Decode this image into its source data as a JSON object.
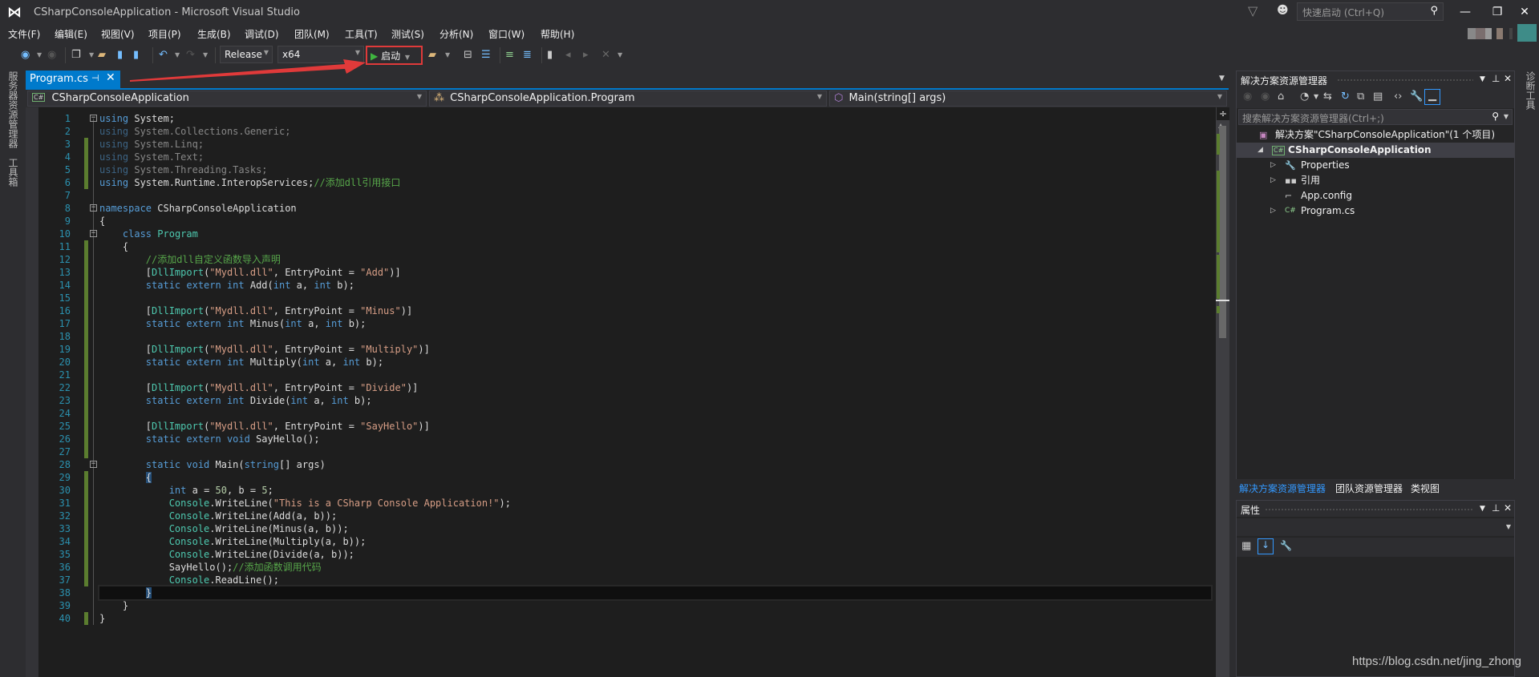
{
  "window": {
    "title": "CSharpConsoleApplication - Microsoft Visual Studio",
    "quick_launch_placeholder": "快速启动 (Ctrl+Q)",
    "controls": {
      "minimize": "—",
      "restore": "❐",
      "close": "✕"
    }
  },
  "menu": [
    "文件(F)",
    "编辑(E)",
    "视图(V)",
    "项目(P)",
    "生成(B)",
    "调试(D)",
    "团队(M)",
    "工具(T)",
    "测试(S)",
    "分析(N)",
    "窗口(W)",
    "帮助(H)"
  ],
  "toolbar": {
    "configuration": "Release",
    "platform": "x64",
    "start_label": "启动",
    "icons": [
      "back-icon",
      "forward-icon",
      "new-project-icon",
      "open-file-icon",
      "save-icon",
      "save-all-icon",
      "undo-icon",
      "redo-icon",
      "find-in-files-icon",
      "step-into-icon",
      "step-over-icon",
      "comment-icon",
      "uncomment-icon",
      "bookmark-icon",
      "prev-bookmark-icon",
      "next-bookmark-icon",
      "clear-bookmarks-icon"
    ]
  },
  "left_strip": {
    "tabs": [
      "服务器资源管理器",
      "工具箱"
    ]
  },
  "right_strip": {
    "tabs": [
      "诊断工具"
    ]
  },
  "document_tab": {
    "label": "Program.cs",
    "pin": "⊣",
    "close": "✕"
  },
  "navbar": {
    "project": "CSharpConsoleApplication",
    "type": "CSharpConsoleApplication.Program",
    "member": "Main(string[] args)"
  },
  "editor": {
    "lines": [
      {
        "n": "1",
        "html": "<span class='k'>using</span> System;"
      },
      {
        "n": "2",
        "html": "<span class='dim'><span class='k'>using</span> System.Collections.Generic;</span>"
      },
      {
        "n": "3",
        "html": "<span class='dim'><span class='k'>using</span> System.Linq;</span>"
      },
      {
        "n": "4",
        "html": "<span class='dim'><span class='k'>using</span> System.Text;</span>"
      },
      {
        "n": "5",
        "html": "<span class='dim'><span class='k'>using</span> System.Threading.Tasks;</span>"
      },
      {
        "n": "6",
        "html": "<span class='k'>using</span> System.Runtime.InteropServices;<span class='c'>//添加dll引用接口</span>"
      },
      {
        "n": "7",
        "html": ""
      },
      {
        "n": "8",
        "html": "<span class='k'>namespace</span> CSharpConsoleApplication"
      },
      {
        "n": "9",
        "html": "{"
      },
      {
        "n": "10",
        "html": "    <span class='k'>class</span> <span class='t'>Program</span>"
      },
      {
        "n": "11",
        "html": "    {"
      },
      {
        "n": "12",
        "html": "        <span class='c'>//添加dll自定义函数导入声明</span>"
      },
      {
        "n": "13",
        "html": "        [<span class='t'>DllImport</span>(<span class='s'>\"Mydll.dll\"</span>, EntryPoint = <span class='s'>\"Add\"</span>)]"
      },
      {
        "n": "14",
        "html": "        <span class='k'>static extern int</span> Add(<span class='k'>int</span> a, <span class='k'>int</span> b);"
      },
      {
        "n": "15",
        "html": ""
      },
      {
        "n": "16",
        "html": "        [<span class='t'>DllImport</span>(<span class='s'>\"Mydll.dll\"</span>, EntryPoint = <span class='s'>\"Minus\"</span>)]"
      },
      {
        "n": "17",
        "html": "        <span class='k'>static extern int</span> Minus(<span class='k'>int</span> a, <span class='k'>int</span> b);"
      },
      {
        "n": "18",
        "html": ""
      },
      {
        "n": "19",
        "html": "        [<span class='t'>DllImport</span>(<span class='s'>\"Mydll.dll\"</span>, EntryPoint = <span class='s'>\"Multiply\"</span>)]"
      },
      {
        "n": "20",
        "html": "        <span class='k'>static extern int</span> Multiply(<span class='k'>int</span> a, <span class='k'>int</span> b);"
      },
      {
        "n": "21",
        "html": ""
      },
      {
        "n": "22",
        "html": "        [<span class='t'>DllImport</span>(<span class='s'>\"Mydll.dll\"</span>, EntryPoint = <span class='s'>\"Divide\"</span>)]"
      },
      {
        "n": "23",
        "html": "        <span class='k'>static extern int</span> Divide(<span class='k'>int</span> a, <span class='k'>int</span> b);"
      },
      {
        "n": "24",
        "html": ""
      },
      {
        "n": "25",
        "html": "        [<span class='t'>DllImport</span>(<span class='s'>\"Mydll.dll\"</span>, EntryPoint = <span class='s'>\"SayHello\"</span>)]"
      },
      {
        "n": "26",
        "html": "        <span class='k'>static extern void</span> SayHello();"
      },
      {
        "n": "27",
        "html": ""
      },
      {
        "n": "28",
        "html": "        <span class='k'>static void</span> Main(<span class='k'>string</span>[] args)"
      },
      {
        "n": "29",
        "html": "        <span class='brace-hl'>{</span>"
      },
      {
        "n": "30",
        "html": "            <span class='k'>int</span> a = <span class='n'>50</span>, b = <span class='n'>5</span>;"
      },
      {
        "n": "31",
        "html": "            <span class='t'>Console</span>.WriteLine(<span class='s'>\"This is a CSharp Console Application!\"</span>);"
      },
      {
        "n": "32",
        "html": "            <span class='t'>Console</span>.WriteLine(Add(a, b));"
      },
      {
        "n": "33",
        "html": "            <span class='t'>Console</span>.WriteLine(Minus(a, b));"
      },
      {
        "n": "34",
        "html": "            <span class='t'>Console</span>.WriteLine(Multiply(a, b));"
      },
      {
        "n": "35",
        "html": "            <span class='t'>Console</span>.WriteLine(Divide(a, b));"
      },
      {
        "n": "36",
        "html": "            SayHello();<span class='c'>//添加函数调用代码</span>"
      },
      {
        "n": "37",
        "html": "            <span class='t'>Console</span>.ReadLine();"
      },
      {
        "n": "38",
        "html": "        <span class='brace-hl'>}</span>"
      },
      {
        "n": "39",
        "html": "    }"
      },
      {
        "n": "40",
        "html": "}"
      }
    ],
    "changed_lines": [
      3,
      4,
      5,
      6,
      11,
      12,
      13,
      14,
      15,
      16,
      17,
      18,
      19,
      20,
      21,
      22,
      23,
      24,
      25,
      26,
      27,
      29,
      30,
      31,
      32,
      33,
      34,
      35,
      36,
      37,
      40
    ],
    "fold_lines": [
      1,
      8,
      10,
      28
    ],
    "current_line": 38
  },
  "solution_explorer": {
    "title": "解决方案资源管理器",
    "search_placeholder": "搜索解决方案资源管理器(Ctrl+;)",
    "tree": [
      {
        "label": "解决方案\"CSharpConsoleApplication\"(1 个项目)",
        "icon": "solution-icon",
        "glyph": "▣",
        "depth": 0,
        "expander": "",
        "selected": false,
        "bold": false
      },
      {
        "label": "CSharpConsoleApplication",
        "icon": "csharp-project-icon",
        "glyph": "C#",
        "depth": 1,
        "expander": "◢",
        "selected": true,
        "bold": true
      },
      {
        "label": "Properties",
        "icon": "wrench-icon",
        "glyph": "🔧",
        "depth": 2,
        "expander": "▷",
        "selected": false,
        "bold": false
      },
      {
        "label": "引用",
        "icon": "references-icon",
        "glyph": "▪▪",
        "depth": 2,
        "expander": "▷",
        "selected": false,
        "bold": false
      },
      {
        "label": "App.config",
        "icon": "config-file-icon",
        "glyph": "⌐",
        "depth": 2,
        "expander": "",
        "selected": false,
        "bold": false
      },
      {
        "label": "Program.cs",
        "icon": "csharp-file-icon",
        "glyph": "C#",
        "depth": 2,
        "expander": "▷",
        "selected": false,
        "bold": false
      }
    ],
    "tabs": [
      "解决方案资源管理器",
      "团队资源管理器",
      "类视图"
    ]
  },
  "properties": {
    "title": "属性"
  },
  "watermark": "https://blog.csdn.net/jing_zhong",
  "colors": {
    "accent": "#007acc",
    "annotation_red": "#e03a3a",
    "change_bar": "#5b7d2f"
  }
}
